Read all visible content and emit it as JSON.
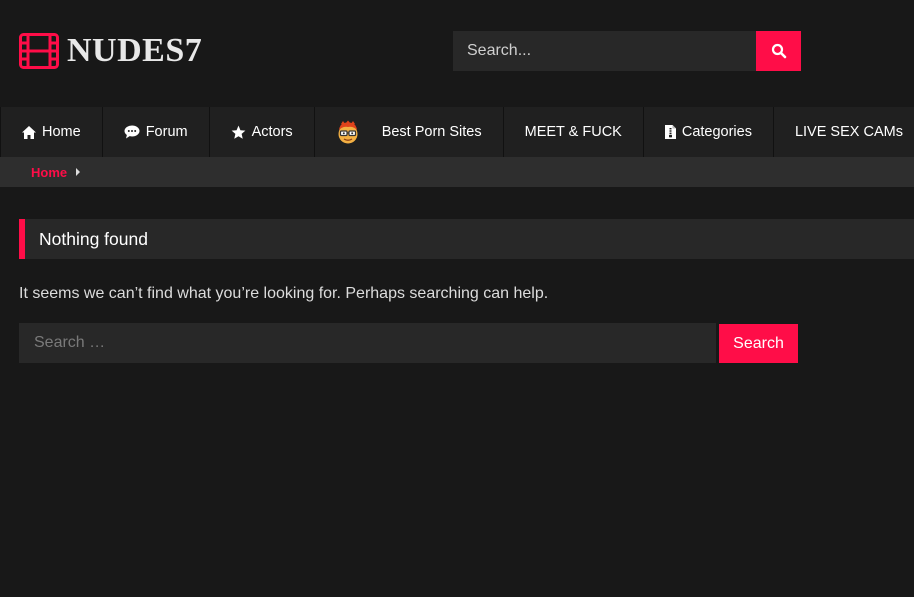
{
  "site": {
    "logo_text": "NUDES7",
    "logo_icon": "film-strip-icon",
    "accent_color": "#ff0d48"
  },
  "header_search": {
    "placeholder": "Search...",
    "button_icon": "search-icon"
  },
  "nav": {
    "items": [
      {
        "label": "Home",
        "icon": "home-icon"
      },
      {
        "label": "Forum",
        "icon": "comment-icon"
      },
      {
        "label": "Actors",
        "icon": "star-icon"
      },
      {
        "label": "Best Porn Sites",
        "icon": "nerd-face-icon"
      },
      {
        "label": "MEET & FUCK",
        "icon": ""
      },
      {
        "label": "Categories",
        "icon": "document-icon"
      },
      {
        "label": "LIVE SEX CAMs",
        "icon": ""
      }
    ]
  },
  "breadcrumb": {
    "home": "Home"
  },
  "main": {
    "title": "Nothing found",
    "message": "It seems we can’t find what you’re looking for. Perhaps searching can help.",
    "search_placeholder": "Search …",
    "search_button": "Search"
  }
}
